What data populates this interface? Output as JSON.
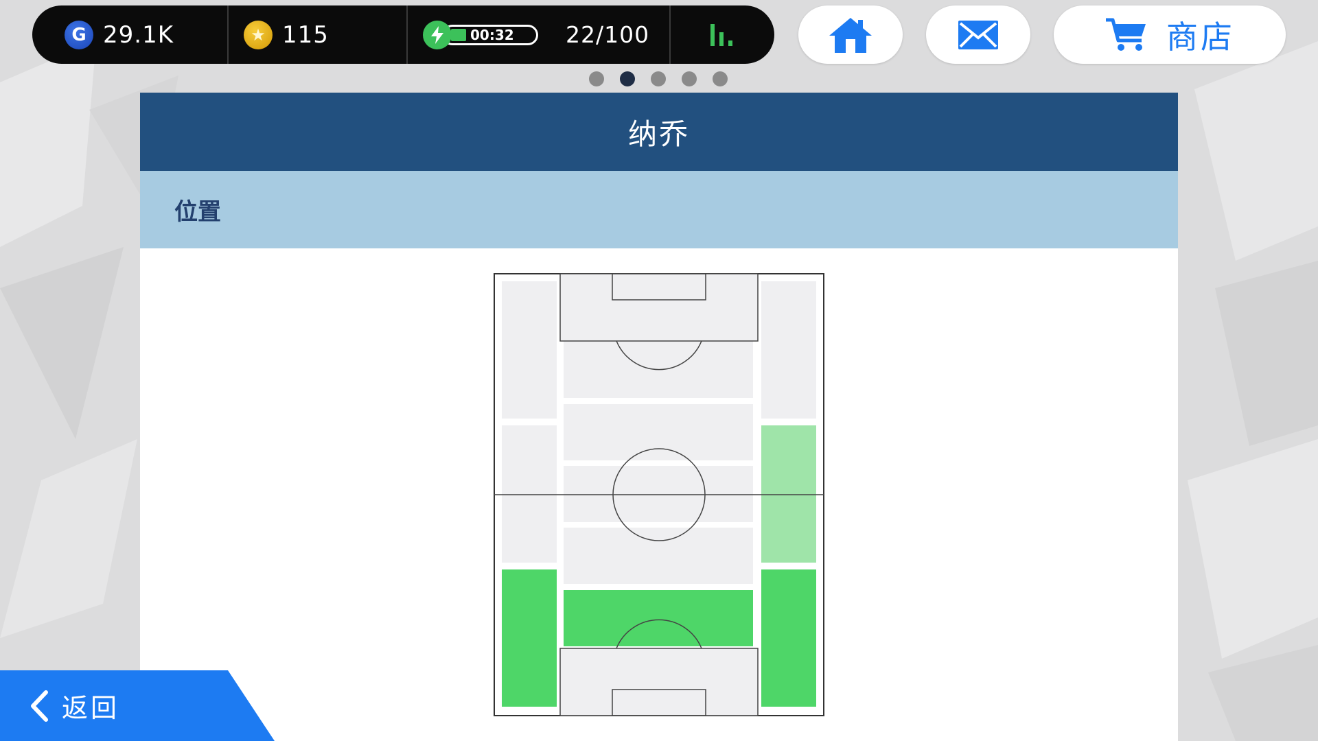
{
  "status_bar": {
    "gp": {
      "icon": "gp-coin-icon",
      "icon_letter": "G",
      "value": "29.1K"
    },
    "coins": {
      "icon": "star-coin-icon",
      "value": "115"
    },
    "energy": {
      "icon": "lightning-icon",
      "timer": "00:32",
      "count": "22/100",
      "fill_fraction": 0.22
    },
    "stats": {
      "icon": "bar-chart-icon"
    }
  },
  "nav_buttons": {
    "home": {
      "icon": "home-icon"
    },
    "mail": {
      "icon": "mail-icon"
    },
    "shop": {
      "icon": "cart-icon",
      "label": "商店"
    }
  },
  "pager": {
    "count": 5,
    "active_index": 1
  },
  "panel": {
    "title": "纳乔",
    "section_label": "位置"
  },
  "position_map": {
    "levels": {
      "LWF": 0,
      "CF": 0,
      "RWF": 0,
      "LMF": 0,
      "AMF": 0,
      "RMF": 1,
      "CMF": 0,
      "DMF": 0,
      "LB": 2,
      "CB": 2,
      "RB": 2
    },
    "colors": {
      "none": "#efeff1",
      "secondary": "#9fe4a9",
      "primary": "#4ed668"
    }
  },
  "back": {
    "icon": "chevron-left-icon",
    "label": "返回"
  },
  "colors": {
    "accent_blue": "#1d7bf2",
    "panel_header": "#22507f",
    "section_bar": "#a7cbe1"
  }
}
